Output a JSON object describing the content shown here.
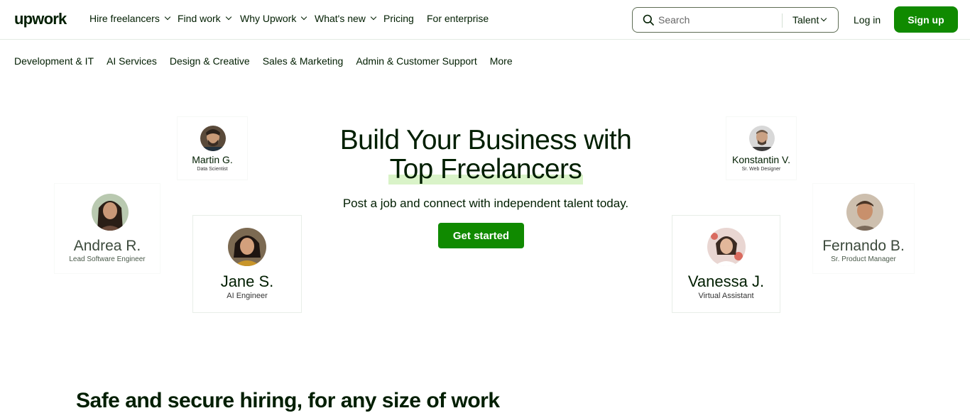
{
  "logo": "upwork",
  "nav": {
    "hire": "Hire freelancers",
    "find": "Find work",
    "why": "Why Upwork",
    "new": "What's new",
    "pricing": "Pricing",
    "enterprise": "For enterprise"
  },
  "search": {
    "placeholder": "Search",
    "type": "Talent"
  },
  "auth": {
    "login": "Log in",
    "signup": "Sign up"
  },
  "categories": [
    "Development & IT",
    "AI Services",
    "Design & Creative",
    "Sales & Marketing",
    "Admin & Customer Support",
    "More"
  ],
  "hero": {
    "title_line1": "Build Your Business with",
    "title_line2": "Top Freelancers",
    "subtitle": "Post a job and connect with independent talent today.",
    "cta": "Get started"
  },
  "freelancers": [
    {
      "name": "Martin G.",
      "role": "Data Scientist"
    },
    {
      "name": "Andrea R.",
      "role": "Lead Software Engineer"
    },
    {
      "name": "Jane S.",
      "role": "AI Engineer"
    },
    {
      "name": "Konstantin V.",
      "role": "Sr. Web Designer"
    },
    {
      "name": "Fernando B.",
      "role": "Sr. Product Manager"
    },
    {
      "name": "Vanessa J.",
      "role": "Virtual Assistant"
    }
  ],
  "section_heading": "Safe and secure hiring, for any size of work",
  "colors": {
    "brand_green": "#108a00",
    "text": "#001e00",
    "highlight": "#d9f3c8"
  }
}
